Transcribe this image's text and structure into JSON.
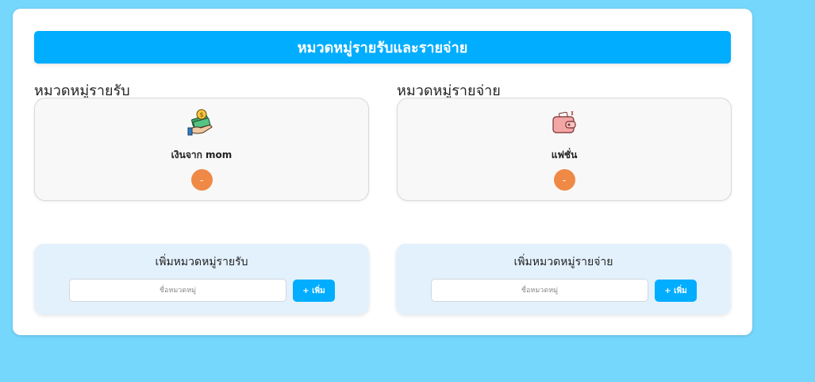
{
  "header": {
    "title": "หมวดหมู่รายรับและรายจ่าย"
  },
  "income": {
    "title": "หมวดหมู่รายรับ",
    "categories": [
      {
        "label": "เงินจาก mom",
        "icon": "money-hand-icon",
        "delete_label": "-"
      }
    ],
    "add_panel": {
      "title": "เพิ่มหมวดหมู่รายรับ",
      "input_placeholder": "ชื่อหมวดหมู่",
      "input_value": "",
      "button_label": "+ เพิ่ม"
    }
  },
  "expense": {
    "title": "หมวดหมู่รายจ่าย",
    "categories": [
      {
        "label": "แฟชั่น",
        "icon": "wallet-icon",
        "delete_label": "-"
      }
    ],
    "add_panel": {
      "title": "เพิ่มหมวดหมู่รายจ่าย",
      "input_placeholder": "ชื่อหมวดหมู่",
      "input_value": "",
      "button_label": "+ เพิ่ม"
    }
  },
  "colors": {
    "page_background": "#76d7fd",
    "accent": "#00adff",
    "delete_button": "#ef8945",
    "add_panel_background": "#e3f1fd"
  }
}
